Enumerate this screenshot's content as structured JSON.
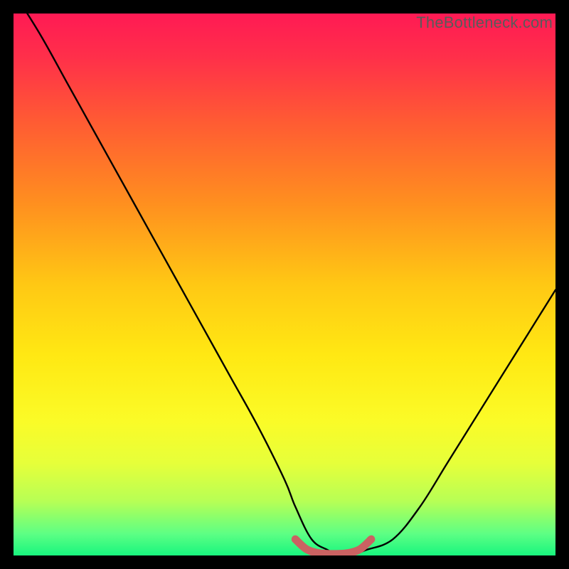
{
  "watermark": "TheBottleneck.com",
  "chart_data": {
    "type": "line",
    "title": "",
    "xlabel": "",
    "ylabel": "",
    "xlim": [
      0,
      100
    ],
    "ylim": [
      0,
      100
    ],
    "series": [
      {
        "name": "bottleneck-curve",
        "x": [
          0,
          5,
          10,
          15,
          20,
          25,
          30,
          35,
          40,
          45,
          50,
          52,
          55,
          58,
          60,
          62,
          65,
          70,
          75,
          80,
          85,
          90,
          95,
          100
        ],
        "y": [
          104,
          96,
          87,
          78,
          69,
          60,
          51,
          42,
          33,
          24,
          14,
          9,
          3,
          1,
          0,
          0,
          1,
          3,
          9,
          17,
          25,
          33,
          41,
          49
        ]
      },
      {
        "name": "optimal-band-marker",
        "x": [
          52,
          54,
          56,
          58,
          60,
          62,
          64,
          66
        ],
        "y": [
          3,
          1.2,
          0.5,
          0.3,
          0.3,
          0.5,
          1.2,
          3
        ]
      }
    ],
    "gradient_stops": [
      {
        "offset": 0.0,
        "color": "#ff1a54"
      },
      {
        "offset": 0.08,
        "color": "#ff2f4a"
      },
      {
        "offset": 0.2,
        "color": "#ff5b33"
      },
      {
        "offset": 0.35,
        "color": "#ff8f1f"
      },
      {
        "offset": 0.5,
        "color": "#ffc814"
      },
      {
        "offset": 0.63,
        "color": "#ffe813"
      },
      {
        "offset": 0.75,
        "color": "#fbfb27"
      },
      {
        "offset": 0.83,
        "color": "#e6ff3a"
      },
      {
        "offset": 0.9,
        "color": "#b7ff55"
      },
      {
        "offset": 0.96,
        "color": "#5dff84"
      },
      {
        "offset": 1.0,
        "color": "#18f57e"
      }
    ],
    "marker_color": "#cb6262",
    "curve_color": "#000000",
    "gradient_top_y": 98,
    "gradient_bottom_y": 0
  }
}
